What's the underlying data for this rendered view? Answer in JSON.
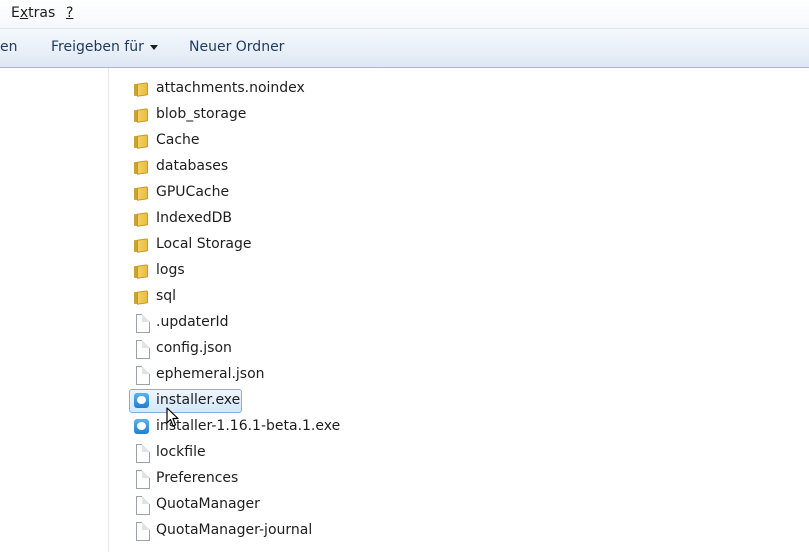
{
  "menubar": {
    "items": [
      {
        "accel": "x",
        "pre": "E",
        "post": "tras"
      },
      {
        "accel": "?",
        "pre": "",
        "post": ""
      }
    ]
  },
  "toolbar": {
    "partial_label": "en",
    "share_label": "Freigeben für",
    "new_folder_label": "Neuer Ordner"
  },
  "files": [
    {
      "name": "attachments.noindex",
      "type": "folder"
    },
    {
      "name": "blob_storage",
      "type": "folder"
    },
    {
      "name": "Cache",
      "type": "folder"
    },
    {
      "name": "databases",
      "type": "folder"
    },
    {
      "name": "GPUCache",
      "type": "folder"
    },
    {
      "name": "IndexedDB",
      "type": "folder"
    },
    {
      "name": "Local Storage",
      "type": "folder"
    },
    {
      "name": "logs",
      "type": "folder"
    },
    {
      "name": "sql",
      "type": "folder"
    },
    {
      "name": ".updaterId",
      "type": "file"
    },
    {
      "name": "config.json",
      "type": "file"
    },
    {
      "name": "ephemeral.json",
      "type": "file"
    },
    {
      "name": "installer.exe",
      "type": "app",
      "selected": true
    },
    {
      "name": "installer-1.16.1-beta.1.exe",
      "type": "app"
    },
    {
      "name": "lockfile",
      "type": "file"
    },
    {
      "name": "Preferences",
      "type": "file"
    },
    {
      "name": "QuotaManager",
      "type": "file"
    },
    {
      "name": "QuotaManager-journal",
      "type": "file"
    }
  ],
  "colors": {
    "selection_border": "#84aee0",
    "folder": "#e8bb3c",
    "app_icon": "#1f7fd1"
  }
}
